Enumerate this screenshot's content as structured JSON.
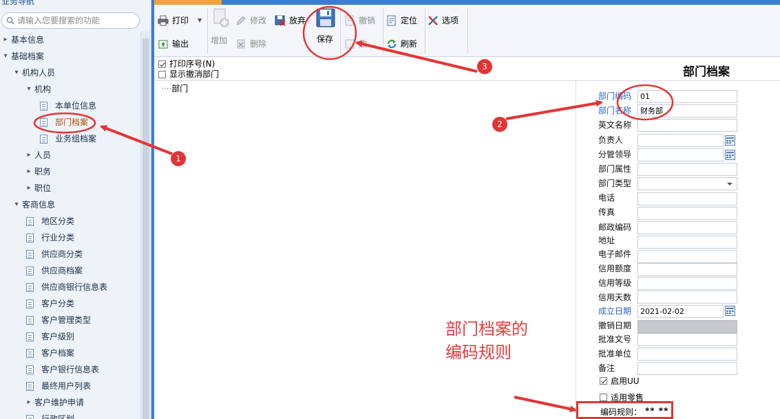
{
  "sidebar": {
    "cut_title": "业务导航",
    "search_placeholder": "请输入您要搜索的功能",
    "items": [
      {
        "label": "基本信息",
        "expanded": false
      },
      {
        "label": "基础档案",
        "expanded": true
      },
      {
        "label": "机构人员",
        "expanded": true
      },
      {
        "label": "机构",
        "expanded": true
      },
      {
        "label": "本单位信息"
      },
      {
        "label": "部门档案",
        "selected": true
      },
      {
        "label": "业务组档案"
      },
      {
        "label": "人员",
        "expanded": false
      },
      {
        "label": "职务",
        "expanded": false
      },
      {
        "label": "职位",
        "expanded": false
      },
      {
        "label": "客商信息",
        "expanded": true
      },
      {
        "label": "地区分类"
      },
      {
        "label": "行业分类"
      },
      {
        "label": "供应商分类"
      },
      {
        "label": "供应商档案"
      },
      {
        "label": "供应商银行信息表"
      },
      {
        "label": "客户分类"
      },
      {
        "label": "客户管理类型"
      },
      {
        "label": "客户级别"
      },
      {
        "label": "客户档案"
      },
      {
        "label": "客户银行信息表"
      },
      {
        "label": "最终用户列表"
      },
      {
        "label": "客户维护申请",
        "expanded": false
      },
      {
        "label": "行政区划"
      }
    ]
  },
  "toolbar": {
    "print": "打印",
    "export": "输出",
    "add": "增加",
    "modify": "修改",
    "delete": "删除",
    "abandon": "放弃",
    "save": "保存",
    "undo": "撤销",
    "undo2": "放",
    "locate": "定位",
    "refresh": "刷新",
    "options": "选项"
  },
  "options_bar": {
    "print_seq": "打印序号(N)",
    "print_seq_checked": true,
    "show_cancelled": "显示撤消部门",
    "show_cancelled_checked": false,
    "page_title": "部门档案"
  },
  "tree": {
    "root": "部门"
  },
  "form": {
    "fields": [
      {
        "label": "部门编码",
        "value": "01",
        "required": true
      },
      {
        "label": "部门名称",
        "value": "财务部",
        "required": true
      },
      {
        "label": "英文名称",
        "value": ""
      },
      {
        "label": "负责人",
        "value": "",
        "picker": true
      },
      {
        "label": "分管领导",
        "value": "",
        "picker": true
      },
      {
        "label": "部门属性",
        "value": ""
      },
      {
        "label": "部门类型",
        "value": "",
        "dropdown": true
      },
      {
        "label": "电话",
        "value": ""
      },
      {
        "label": "传真",
        "value": ""
      },
      {
        "label": "邮政编码",
        "value": ""
      },
      {
        "label": "地址",
        "value": ""
      },
      {
        "label": "电子邮件",
        "value": ""
      },
      {
        "label": "信用额度",
        "value": ""
      },
      {
        "label": "信用等级",
        "value": ""
      },
      {
        "label": "信用天数",
        "value": ""
      },
      {
        "label": "成立日期",
        "value": "2021-02-02",
        "required": true,
        "picker": true
      },
      {
        "label": "撤销日期",
        "value": "",
        "disabled": true
      },
      {
        "label": "批准文号",
        "value": ""
      },
      {
        "label": "批准单位",
        "value": ""
      },
      {
        "label": "备注",
        "value": ""
      }
    ],
    "enable_uu": {
      "label": "启用UU",
      "checked": true
    },
    "retail": {
      "label": "适用零售",
      "checked": false
    },
    "rule_label": "编码规则：",
    "rule_value": "** **"
  },
  "annotations": {
    "badge1": "1",
    "badge2": "2",
    "badge3": "3",
    "note_line1": "部门档案的",
    "note_line2": "编码规则",
    "accent": "#e53333"
  }
}
